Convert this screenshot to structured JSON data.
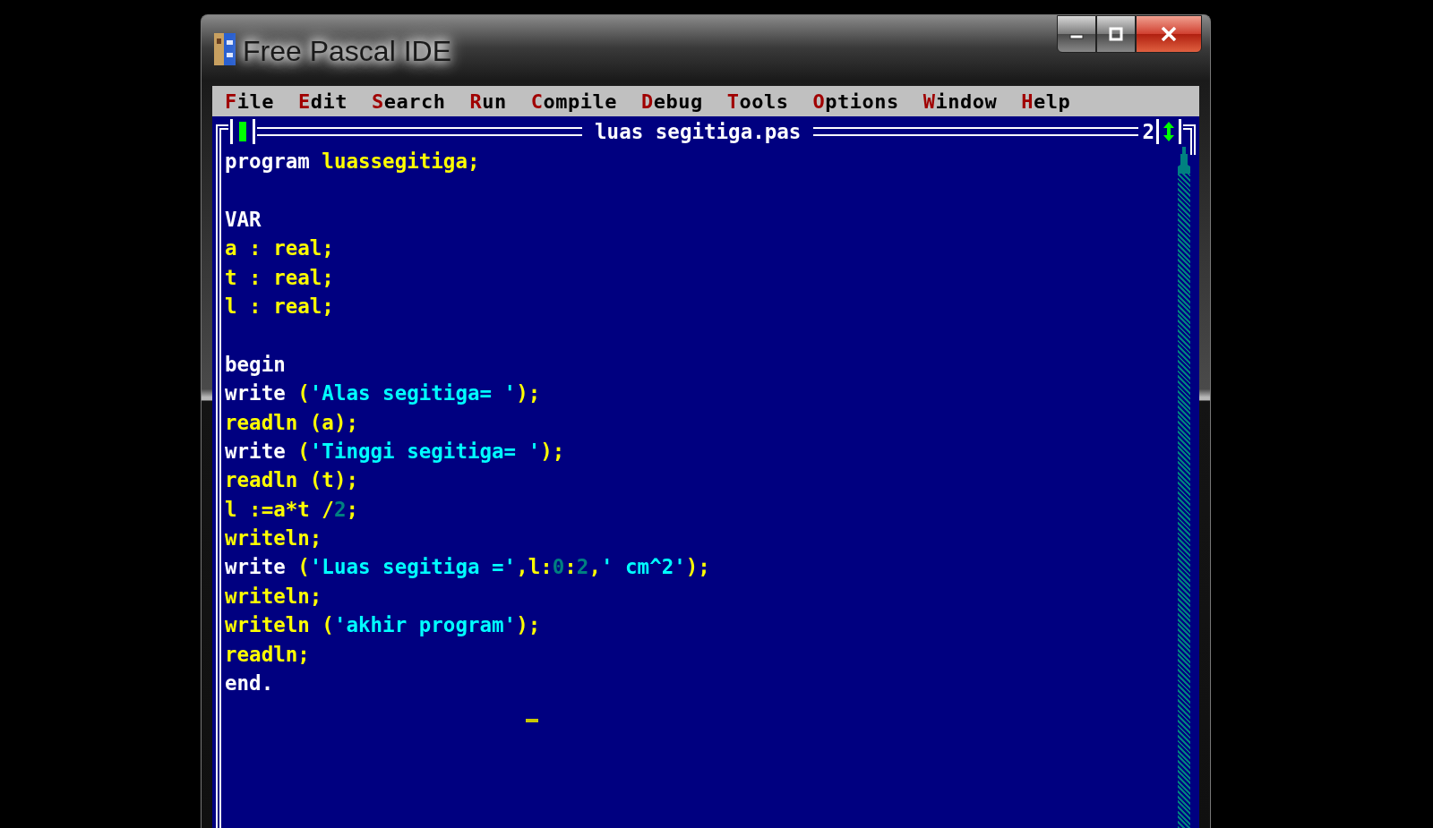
{
  "window": {
    "title": "Free Pascal IDE"
  },
  "menu": [
    {
      "label": "File"
    },
    {
      "label": "Edit"
    },
    {
      "label": "Search"
    },
    {
      "label": "Run"
    },
    {
      "label": "Compile"
    },
    {
      "label": "Debug"
    },
    {
      "label": "Tools"
    },
    {
      "label": "Options"
    },
    {
      "label": "Window"
    },
    {
      "label": "Help"
    }
  ],
  "editor": {
    "title": "luas segitiga.pas",
    "window_number": "2",
    "cursor": true,
    "paragraphs": [
      {
        "lines": [
          {
            "tokens": [
              {
                "kind": "keyword",
                "text": "program"
              },
              {
                "kind": "plain",
                "text": " luassegitiga;"
              }
            ]
          }
        ]
      },
      {
        "lines": [
          {
            "tokens": [
              {
                "kind": "keyword",
                "text": "VAR"
              }
            ]
          },
          {
            "tokens": [
              {
                "kind": "plain",
                "text": "a : real;"
              }
            ]
          },
          {
            "tokens": [
              {
                "kind": "plain",
                "text": "t : real;"
              }
            ]
          },
          {
            "tokens": [
              {
                "kind": "plain",
                "text": "l : real;"
              }
            ]
          }
        ]
      },
      {
        "lines": [
          {
            "tokens": [
              {
                "kind": "keyword",
                "text": "begin"
              }
            ]
          },
          {
            "tokens": [
              {
                "kind": "keyword",
                "text": "write"
              },
              {
                "kind": "plain",
                "text": " ("
              },
              {
                "kind": "string",
                "text": "'Alas segitiga= '"
              },
              {
                "kind": "plain",
                "text": ");"
              }
            ]
          },
          {
            "tokens": [
              {
                "kind": "plain",
                "text": "readln (a);"
              }
            ]
          },
          {
            "tokens": [
              {
                "kind": "keyword",
                "text": "write"
              },
              {
                "kind": "plain",
                "text": " ("
              },
              {
                "kind": "string",
                "text": "'Tinggi segitiga= '"
              },
              {
                "kind": "plain",
                "text": ");"
              }
            ]
          },
          {
            "tokens": [
              {
                "kind": "plain",
                "text": "readln (t);"
              }
            ]
          },
          {
            "tokens": [
              {
                "kind": "plain",
                "text": "l :=a*t /"
              },
              {
                "kind": "number",
                "text": "2"
              },
              {
                "kind": "plain",
                "text": ";"
              }
            ]
          },
          {
            "tokens": [
              {
                "kind": "plain",
                "text": "writeln;"
              }
            ]
          },
          {
            "tokens": [
              {
                "kind": "keyword",
                "text": "write"
              },
              {
                "kind": "plain",
                "text": " ("
              },
              {
                "kind": "string",
                "text": "'Luas segitiga ='"
              },
              {
                "kind": "plain",
                "text": ",l:"
              },
              {
                "kind": "number",
                "text": "0"
              },
              {
                "kind": "plain",
                "text": ":"
              },
              {
                "kind": "number",
                "text": "2"
              },
              {
                "kind": "plain",
                "text": ","
              },
              {
                "kind": "string",
                "text": "' cm^2'"
              },
              {
                "kind": "plain",
                "text": ");"
              }
            ]
          },
          {
            "tokens": [
              {
                "kind": "plain",
                "text": "writeln;"
              }
            ]
          },
          {
            "tokens": [
              {
                "kind": "plain",
                "text": "writeln ("
              },
              {
                "kind": "string",
                "text": "'akhir program'"
              },
              {
                "kind": "plain",
                "text": ");"
              }
            ]
          },
          {
            "tokens": [
              {
                "kind": "plain",
                "text": "readln;"
              }
            ]
          },
          {
            "tokens": [
              {
                "kind": "keyword",
                "text": "end."
              }
            ]
          }
        ]
      }
    ]
  }
}
